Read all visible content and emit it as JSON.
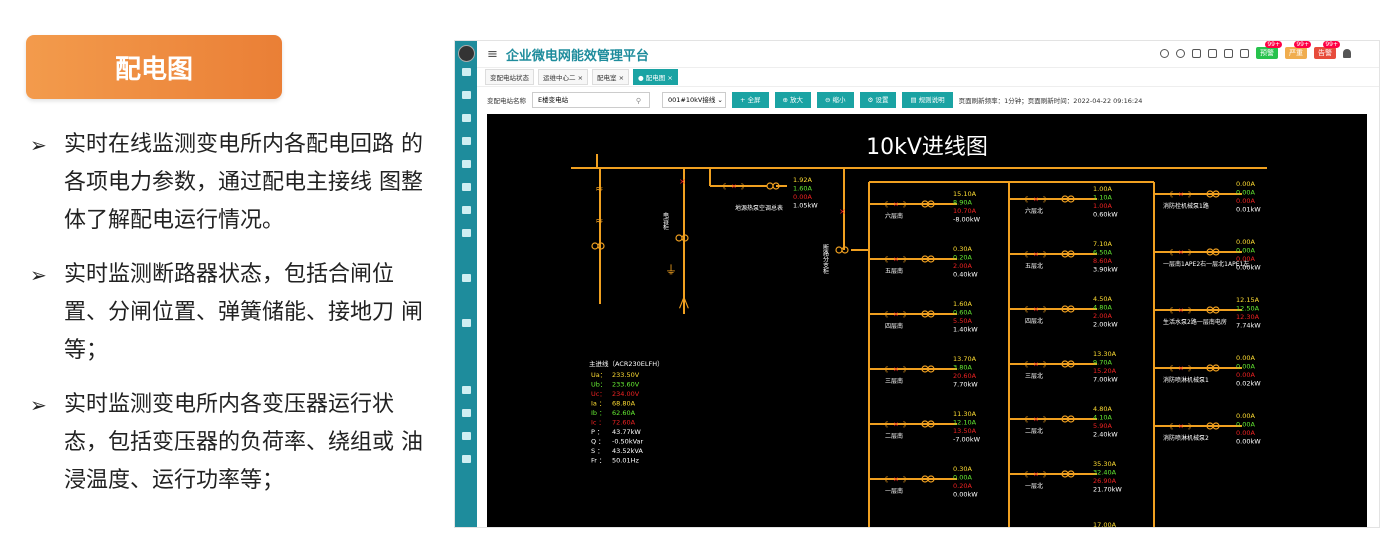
{
  "panel": {
    "title": "配电图",
    "bullets": [
      "实时在线监测变电所内各配电回路 的各项电力参数，通过配电主接线 图整体了解配电运行情况。",
      "实时监测断路器状态，包括合闸位 置、分闸位置、弹簧储能、接地刀 闸等；",
      "实时监测变电所内各变压器运行状 态，包括变压器的负荷率、绕组或 油浸温度、运行功率等；"
    ]
  },
  "app": {
    "title": "企业微电网能效管理平台",
    "badges": [
      {
        "label": "预警",
        "count": "99+",
        "color": "#27c24c"
      },
      {
        "label": "严重",
        "count": "99+",
        "color": "#f0ad4e"
      },
      {
        "label": "告警",
        "count": "99+",
        "color": "#e74c3c"
      }
    ],
    "tabs": [
      "变配电站状态",
      "运维中心二 ×",
      "配电室 ×",
      "● 配电图 ×"
    ],
    "toolbar": {
      "station_label": "变配电站名称",
      "station_value": "E楼变电站",
      "line_value": "001#10kV接线 ⌄",
      "buttons": [
        "+ 全屏",
        "⊕ 放大",
        "⊖ 缩小",
        "⚙ 设置",
        "▤ 规则说明"
      ],
      "refresh_text": "页面刷新频率：1分钟；页面刷新时间：2022-04-22 09:16:24"
    }
  },
  "diagram": {
    "title": "10kV进线图",
    "main_feeder": {
      "title": "主进线（ACR230ELFH）",
      "rows": [
        {
          "k": "Ua：",
          "v": "233.50V",
          "c": "#fd3"
        },
        {
          "k": "Ub：",
          "v": "233.60V",
          "c": "#6e3"
        },
        {
          "k": "Uc：",
          "v": "234.00V",
          "c": "#e22"
        },
        {
          "k": "Ia ：",
          "v": "68.80A",
          "c": "#fd3"
        },
        {
          "k": "Ib ：",
          "v": "62.60A",
          "c": "#6e3"
        },
        {
          "k": "Ic ：",
          "v": "72.60A",
          "c": "#e22"
        },
        {
          "k": "P ：",
          "v": "43.77kW",
          "c": "#fff"
        },
        {
          "k": "Q ：",
          "v": "-0.50kVar",
          "c": "#fff"
        },
        {
          "k": "S ：",
          "v": "43.52kVA",
          "c": "#fff"
        },
        {
          "k": "Fr ：",
          "v": "50.01Hz",
          "c": "#fff"
        }
      ]
    },
    "cabinet_a": "电容柜",
    "cabinet_b": "断路分支柜",
    "top_branch": {
      "name": "地源热泵空调总表",
      "v": [
        "1.92A",
        "1.60A",
        "0.00A",
        "1.05kW"
      ]
    },
    "col1": [
      {
        "name": "六层南",
        "v": [
          "15.10A",
          "8.90A",
          "10.70A",
          "-8.00kW"
        ]
      },
      {
        "name": "五层南",
        "v": [
          "0.30A",
          "0.20A",
          "2.00A",
          "0.40kW"
        ]
      },
      {
        "name": "四层南",
        "v": [
          "1.60A",
          "0.60A",
          "5.50A",
          "1.40kW"
        ]
      },
      {
        "name": "三层南",
        "v": [
          "13.70A",
          "3.80A",
          "20.60A",
          "7.70kW"
        ]
      },
      {
        "name": "二层南",
        "v": [
          "11.30A",
          "12.10A",
          "13.50A",
          "-7.00kW"
        ]
      },
      {
        "name": "一层南",
        "v": [
          "0.30A",
          "0.00A",
          "0.20A",
          "0.00kW"
        ]
      }
    ],
    "col2": [
      {
        "name": "六层北",
        "v": [
          "1.00A",
          "1.10A",
          "1.00A",
          "0.60kW"
        ]
      },
      {
        "name": "五层北",
        "v": [
          "7.10A",
          "6.50A",
          "8.60A",
          "3.90kW"
        ]
      },
      {
        "name": "四层北",
        "v": [
          "4.50A",
          "4.80A",
          "2.00A",
          "2.00kW"
        ]
      },
      {
        "name": "三层北",
        "v": [
          "13.30A",
          "9.70A",
          "15.20A",
          "7.00kW"
        ]
      },
      {
        "name": "二层北",
        "v": [
          "4.80A",
          "4.10A",
          "5.90A",
          "2.40kW"
        ]
      },
      {
        "name": "一层北",
        "v": [
          "35.30A",
          "32.40A",
          "26.90A",
          "21.70kW"
        ]
      }
    ],
    "col2_partial": "17.00A",
    "col3": [
      {
        "name": "消防栓机械泵1路",
        "v": [
          "0.00A",
          "0.00A",
          "0.00A",
          "0.01kW"
        ]
      },
      {
        "name": "一层南1APE2右一层北1APE1左",
        "v": [
          "0.00A",
          "0.00A",
          "0.00A",
          "0.00kW"
        ]
      },
      {
        "name": "生活水泵2路一层南电房",
        "v": [
          "12.15A",
          "12.50A",
          "12.30A",
          "7.74kW"
        ]
      },
      {
        "name": "消防喷淋机械泵1",
        "v": [
          "0.00A",
          "0.00A",
          "0.00A",
          "0.02kW"
        ]
      },
      {
        "name": "消防喷淋机械泵2",
        "v": [
          "0.00A",
          "0.00A",
          "0.00A",
          "0.00kW"
        ]
      }
    ]
  }
}
